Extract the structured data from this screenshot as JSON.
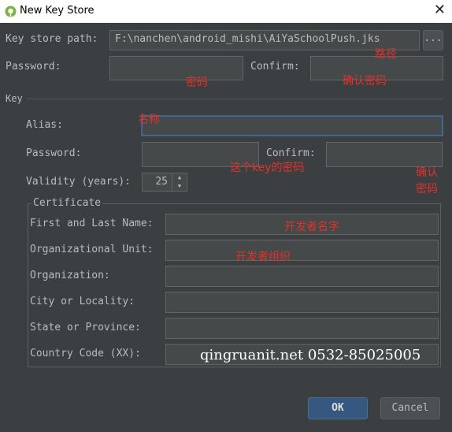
{
  "window": {
    "title": "New Key Store"
  },
  "keystore": {
    "path_label": "Key store path:",
    "path_value": "F:\\nanchen\\android_mishi\\AiYaSchoolPush.jks",
    "browse_label": "...",
    "password_label": "Password:",
    "confirm_label": "Confirm:"
  },
  "key_section": {
    "label": "Key",
    "alias_label": "Alias:",
    "password_label": "Password:",
    "confirm_label": "Confirm:",
    "validity_label": "Validity (years):",
    "validity_value": "25"
  },
  "certificate": {
    "title": "Certificate",
    "first_last_label": "First and Last Name:",
    "org_unit_label": "Organizational Unit:",
    "org_label": "Organization:",
    "city_label": "City or Locality:",
    "state_label": "State or Province:",
    "country_label": "Country Code (XX):"
  },
  "buttons": {
    "ok": "OK",
    "cancel": "Cancel"
  },
  "annotations": {
    "path": "路径",
    "password": "密码",
    "confirm_password": "确认密码",
    "alias": "名称",
    "key_password": "这个key的密码",
    "key_confirm_1": "确认",
    "key_confirm_2": "密码",
    "dev_name": "开发者名字",
    "dev_org": "开发者组织"
  },
  "watermark": "qingruanit.net 0532-85025005"
}
